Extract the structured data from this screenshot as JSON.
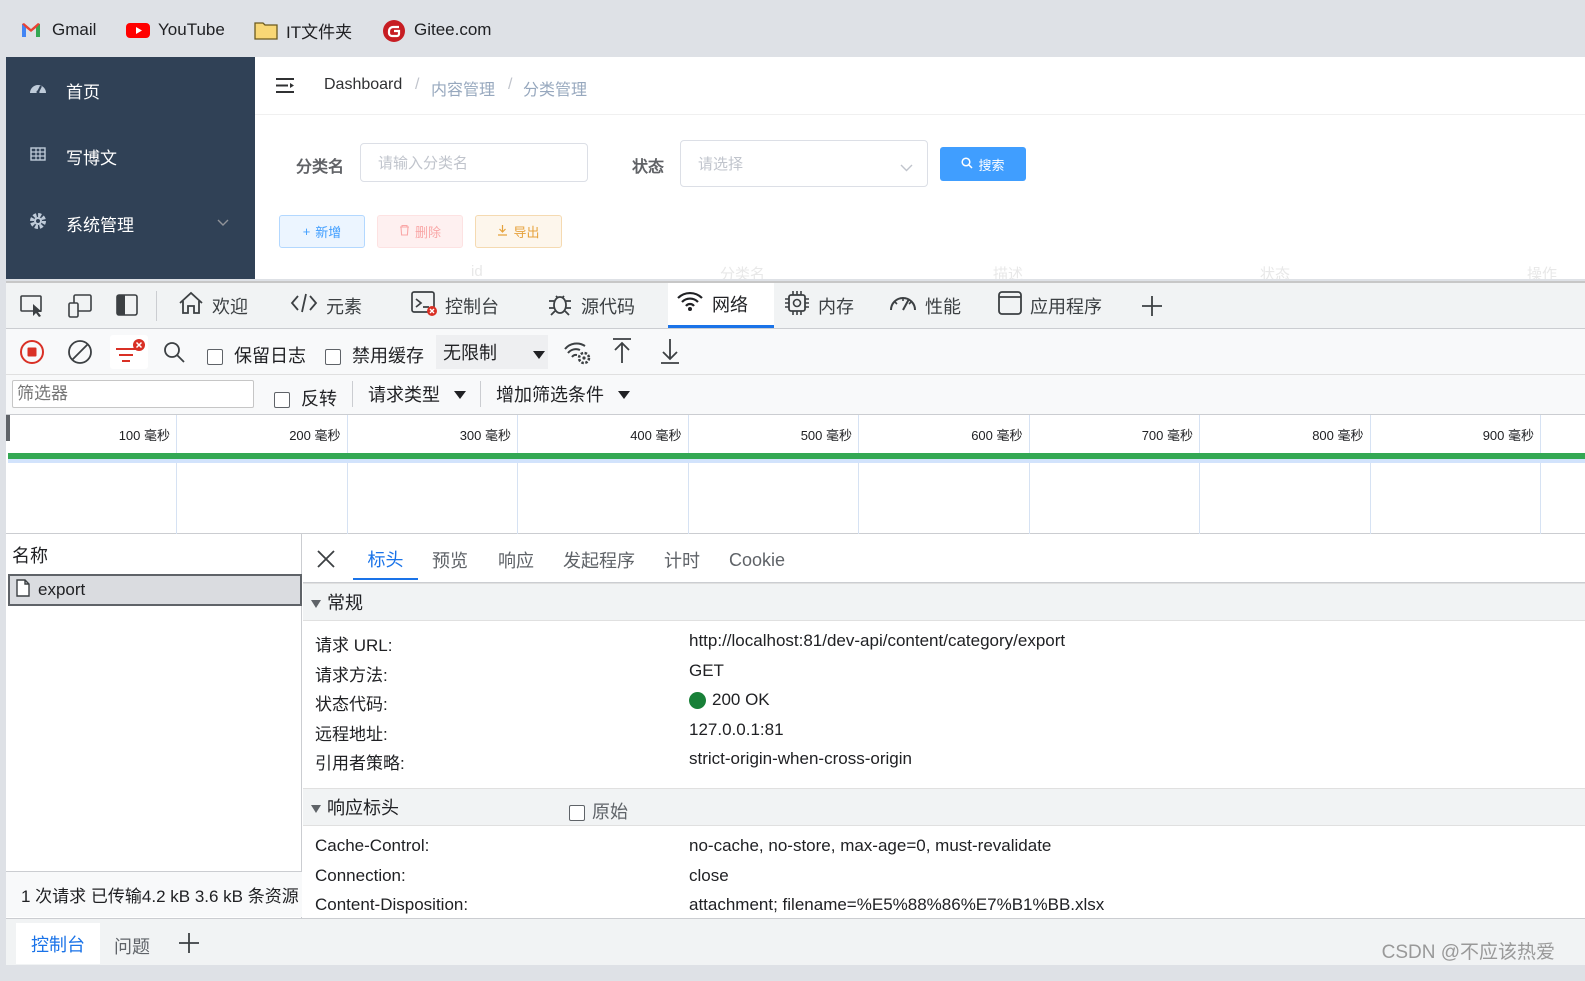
{
  "bookmarks": [
    {
      "label": "Gmail",
      "icon": "gmail-icon"
    },
    {
      "label": "YouTube",
      "icon": "youtube-icon"
    },
    {
      "label": "IT文件夹",
      "icon": "folder-icon"
    },
    {
      "label": "Gitee.com",
      "icon": "gitee-icon"
    }
  ],
  "sidebar": {
    "items": [
      {
        "label": "首页",
        "icon": "dashboard-icon"
      },
      {
        "label": "写博文",
        "icon": "grid-icon"
      },
      {
        "label": "系统管理",
        "icon": "gear-icon"
      }
    ]
  },
  "breadcrumb": [
    "Dashboard",
    "内容管理",
    "分类管理"
  ],
  "search_form": {
    "category_label": "分类名",
    "category_placeholder": "请输入分类名",
    "status_label": "状态",
    "status_placeholder": "请选择",
    "search_button": "搜索"
  },
  "actions": {
    "add": "新增",
    "delete": "删除",
    "export": "导出"
  },
  "table_headers_faded": [
    "id",
    "分类名",
    "描述",
    "状态",
    "操作"
  ],
  "devtools": {
    "tabs": [
      {
        "label": "欢迎",
        "icon": "home-icon"
      },
      {
        "label": "元素",
        "icon": "code-icon"
      },
      {
        "label": "控制台",
        "icon": "console-icon"
      },
      {
        "label": "源代码",
        "icon": "bug-icon"
      },
      {
        "label": "网络",
        "icon": "wifi-icon"
      },
      {
        "label": "内存",
        "icon": "memory-icon"
      },
      {
        "label": "性能",
        "icon": "gauge-icon"
      },
      {
        "label": "应用程序",
        "icon": "app-icon"
      }
    ],
    "active_tab": "网络",
    "toolbar": {
      "preserve_log": "保留日志",
      "disable_cache": "禁用缓存",
      "throttling": "无限制"
    },
    "filter": {
      "placeholder": "筛选器",
      "invert": "反转",
      "request_type": "请求类型",
      "more_filters": "增加筛选条件"
    },
    "timeline_ticks": [
      "100 毫秒",
      "200 毫秒",
      "300 毫秒",
      "400 毫秒",
      "500 毫秒",
      "600 毫秒",
      "700 毫秒",
      "800 毫秒",
      "900 毫秒"
    ],
    "name_header": "名称",
    "requests": [
      "export"
    ],
    "status_summary": "1 次请求  已传输4.2 kB  3.6 kB 条资源",
    "detail_tabs": [
      "标头",
      "预览",
      "响应",
      "发起程序",
      "计时",
      "Cookie"
    ],
    "active_detail_tab": "标头",
    "general": {
      "title": "常规",
      "rows": [
        {
          "key": "请求 URL:",
          "value": "http://localhost:81/dev-api/content/category/export"
        },
        {
          "key": "请求方法:",
          "value": "GET"
        },
        {
          "key": "状态代码:",
          "value": "200 OK"
        },
        {
          "key": "远程地址:",
          "value": "127.0.0.1:81"
        },
        {
          "key": "引用者策略:",
          "value": "strict-origin-when-cross-origin"
        }
      ]
    },
    "response_headers": {
      "title": "响应标头",
      "raw_label": "原始",
      "rows": [
        {
          "key": "Cache-Control:",
          "value": "no-cache, no-store, max-age=0, must-revalidate"
        },
        {
          "key": "Connection:",
          "value": "close"
        },
        {
          "key": "Content-Disposition:",
          "value": "attachment; filename=%E5%88%86%E7%B1%BB.xlsx"
        }
      ]
    },
    "drawer_tabs": [
      "控制台",
      "问题"
    ]
  },
  "watermark": "CSDN @不应该热爱",
  "colors": {
    "primary": "#409eff",
    "sidebar": "#304156",
    "status_ok": "#188038",
    "devtools_accent": "#1a73e8"
  }
}
